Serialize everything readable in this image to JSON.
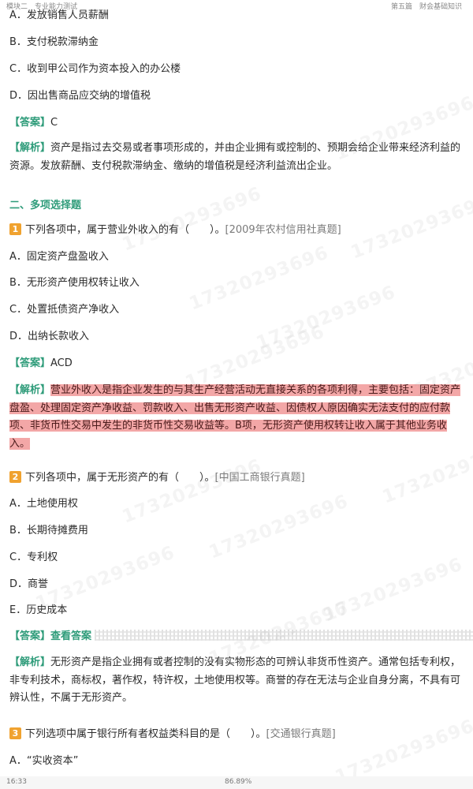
{
  "header": {
    "left": "模块二　专业能力测试",
    "right": "第五篇　财会基础知识"
  },
  "q_prev": {
    "options": [
      "A．发放销售人员薪酬",
      "B．支付税款滞纳金",
      "C．收到甲公司作为资本投入的办公楼",
      "D．因出售商品应交纳的增值税"
    ],
    "answer_label": "【答案】",
    "answer": "C",
    "analysis_label": "【解析】",
    "analysis": "资产是指过去交易或者事项形成的，并由企业拥有或控制的、预期会给企业带来经济利益的资源。发放薪酬、支付税款滞纳金、缴纳的增值税是经济利益流出企业。"
  },
  "section_title": "二、多项选择题",
  "q1": {
    "number": "1",
    "stem": "下列各项中，属于营业外收入的有（　　）。",
    "source": "[2009年农村信用社真题]",
    "options": [
      "A．固定资产盘盈收入",
      "B．无形资产使用权转让收入",
      "C．处置抵债资产净收入",
      "D．出纳长款收入"
    ],
    "answer_label": "【答案】",
    "answer": "ACD",
    "analysis_label": "【解析】",
    "analysis": "营业外收入是指企业发生的与其生产经营活动无直接关系的各项利得，主要包括：固定资产盘盈、处理固定资产净收益、罚款收入、出售无形资产收益、因债权人原因确实无法支付的应付款项、非货币性交易中发生的非货币性交易收益等。B项，无形资产使用权转让收入属于其他业务收入。"
  },
  "q2": {
    "number": "2",
    "stem": "下列各项中，属于无形资产的有（　　）。",
    "source": "[中国工商银行真题]",
    "options": [
      "A．土地使用权",
      "B．长期待摊费用",
      "C．专利权",
      "D．商誉",
      "E．历史成本"
    ],
    "answer_label": "【答案】",
    "answer_link": "查看答案",
    "analysis_label": "【解析】",
    "analysis": "无形资产是指企业拥有或者控制的没有实物形态的可辨认非货币性资产。通常包括专利权，非专利技术，商标权，著作权，特许权，土地使用权等。商誉的存在无法与企业自身分离，不具有可辨认性，不属于无形资产。"
  },
  "q3": {
    "number": "3",
    "stem": "下列选项中属于银行所有者权益类科目的是（　　）。",
    "source": "[交通银行真题]",
    "options": [
      "A．“实收资本”"
    ]
  },
  "watermark_text": "17320293696",
  "footer": {
    "time": "16:33",
    "progress": "86.89%"
  }
}
